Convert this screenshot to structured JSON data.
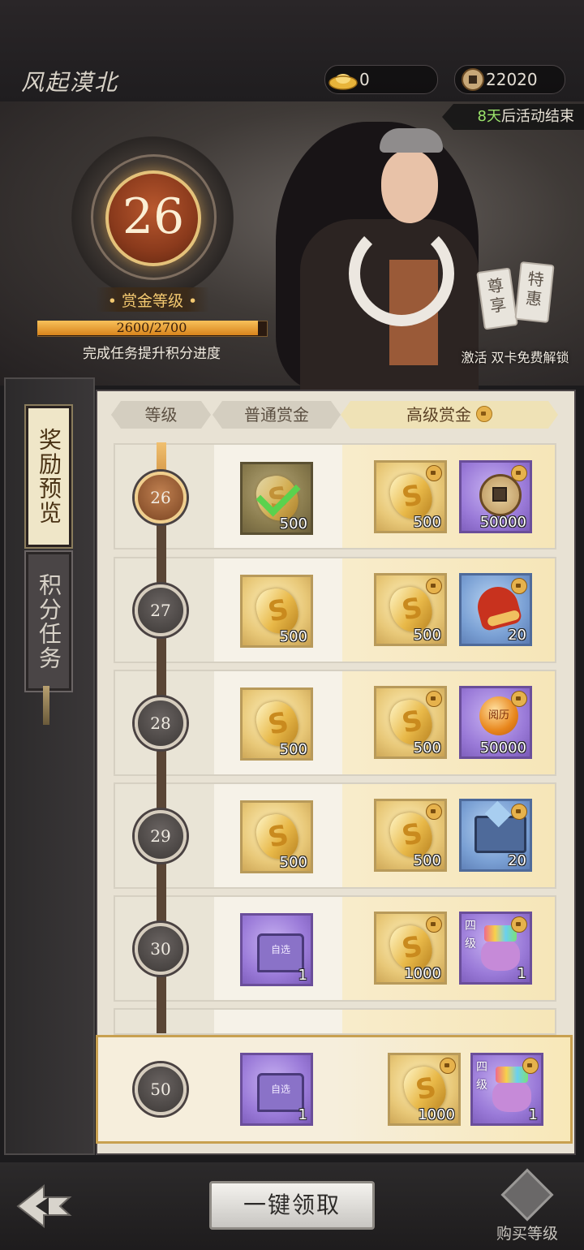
{
  "header": {
    "title": "风起漠北",
    "currency_ingot": "0",
    "currency_coin": "22020"
  },
  "banner": {
    "countdown_days": "8天",
    "countdown_suffix": "后活动结束",
    "level": "26",
    "level_label": "• 赏金等级 •",
    "progress_text": "2600/2700",
    "progress_fraction": 0.963,
    "progress_tip": "完成任务提升积分进度",
    "tag_left": "尊享",
    "tag_right": "特惠",
    "unlock_text": "激活 双卡免费解锁"
  },
  "side_tabs": {
    "reward_preview": "奖励预览",
    "point_tasks": "积分任务"
  },
  "table": {
    "headers": {
      "level": "等级",
      "normal": "普通赏金",
      "premium": "高级赏金"
    },
    "rows": [
      {
        "level": "26",
        "normal": {
          "qty": "500",
          "claimed": true
        },
        "premium1": {
          "qty": "500"
        },
        "premium2": {
          "qty": "50000",
          "icon": "copper-coin-icon"
        }
      },
      {
        "level": "27",
        "normal": {
          "qty": "500"
        },
        "premium1": {
          "qty": "500"
        },
        "premium2": {
          "qty": "20",
          "icon": "red-hat-icon"
        }
      },
      {
        "level": "28",
        "normal": {
          "qty": "500"
        },
        "premium1": {
          "qty": "500"
        },
        "premium2": {
          "qty": "50000",
          "icon": "experience-orb-icon",
          "label": "阅历"
        }
      },
      {
        "level": "29",
        "normal": {
          "qty": "500"
        },
        "premium1": {
          "qty": "500"
        },
        "premium2": {
          "qty": "20",
          "icon": "anvil-icon"
        }
      },
      {
        "level": "30",
        "normal": {
          "qty": "1",
          "label": "自选"
        },
        "premium1": {
          "qty": "1000"
        },
        "premium2": {
          "qty": "1",
          "label": "四级"
        }
      }
    ],
    "pinned_row": {
      "level": "50",
      "normal": {
        "qty": "1",
        "label": "自选"
      },
      "premium1": {
        "qty": "1000"
      },
      "premium2": {
        "qty": "1",
        "label": "四级"
      }
    }
  },
  "footer": {
    "claim_all": "一键领取",
    "buy_level": "购买等级"
  }
}
